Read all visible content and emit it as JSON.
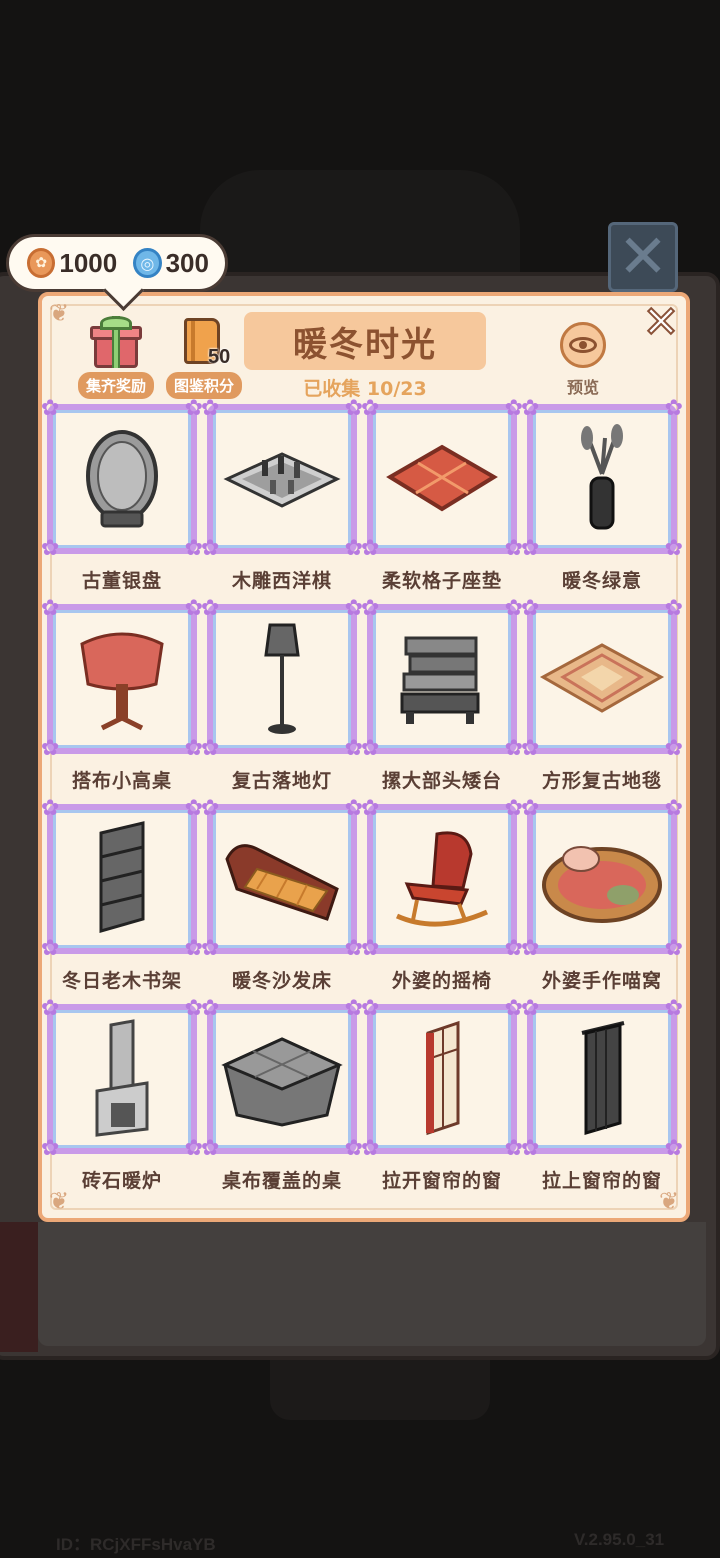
{
  "currency": {
    "coins": "1000",
    "gems": "300"
  },
  "header": {
    "reward_label": "集齐奖励",
    "score_label": "图鉴积分",
    "score_value": "50",
    "title": "暖冬时光",
    "collected": "已收集 10/23",
    "preview_label": "预览",
    "close_icon": "✕"
  },
  "items": [
    {
      "name": "古董银盘",
      "icon": "silver-plate-icon"
    },
    {
      "name": "木雕西洋棋",
      "icon": "chess-board-icon"
    },
    {
      "name": "柔软格子座垫",
      "icon": "cushion-icon"
    },
    {
      "name": "暖冬绿意",
      "icon": "vase-plant-icon"
    },
    {
      "name": "搭布小高桌",
      "icon": "side-table-icon"
    },
    {
      "name": "复古落地灯",
      "icon": "floor-lamp-icon"
    },
    {
      "name": "摞大部头矮台",
      "icon": "book-stack-table-icon"
    },
    {
      "name": "方形复古地毯",
      "icon": "rug-icon"
    },
    {
      "name": "冬日老木书架",
      "icon": "bookshelf-icon"
    },
    {
      "name": "暖冬沙发床",
      "icon": "sofa-bed-icon"
    },
    {
      "name": "外婆的摇椅",
      "icon": "rocking-chair-icon"
    },
    {
      "name": "外婆手作喵窝",
      "icon": "cat-bed-icon"
    },
    {
      "name": "砖石暖炉",
      "icon": "fireplace-icon"
    },
    {
      "name": "桌布覆盖的桌",
      "icon": "covered-table-icon"
    },
    {
      "name": "拉开窗帘的窗",
      "icon": "open-curtain-window-icon"
    },
    {
      "name": "拉上窗帘的窗",
      "icon": "closed-curtain-window-icon"
    }
  ],
  "footer": {
    "id": "ID：RCjXFFsHvaYB",
    "version": "V.2.95.0_31"
  },
  "colors": {
    "panel_bg": "#fbf1e2",
    "panel_border": "#eca877",
    "frame_purple": "#c99ae8",
    "title_bg": "#f6c89c",
    "title_text": "#8c5230",
    "accent_label": "#e09a5f"
  }
}
